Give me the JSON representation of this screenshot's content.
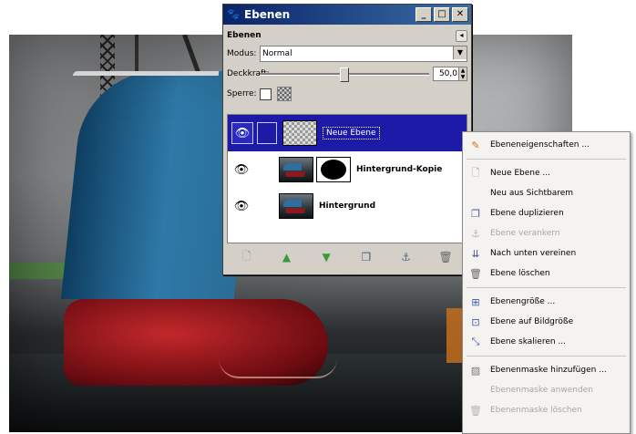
{
  "dialog": {
    "title": "Ebenen",
    "panel_title": "Ebenen",
    "mode_label": "Modus:",
    "mode_value": "Normal",
    "opacity_label": "Deckkraft:",
    "opacity_value": "50,0",
    "opacity_fraction": 0.5,
    "lock_label": "Sperre:",
    "layers": [
      {
        "name": "Neue Ebene",
        "selected": true
      },
      {
        "name": "Hintergrund-Kopie",
        "selected": false
      },
      {
        "name": "Hintergrund",
        "selected": false
      }
    ]
  },
  "context_menu": {
    "items": [
      {
        "label": "Ebeneneigenschaften ...",
        "icon": "edit-icon",
        "enabled": true
      },
      {
        "label": "Neue Ebene ...",
        "icon": "new-document-icon",
        "enabled": true
      },
      {
        "label": "Neu aus Sichtbarem",
        "icon": "",
        "enabled": true
      },
      {
        "label": "Ebene duplizieren",
        "icon": "duplicate-icon",
        "enabled": true
      },
      {
        "label": "Ebene verankern",
        "icon": "anchor-icon",
        "enabled": false
      },
      {
        "label": "Nach unten vereinen",
        "icon": "merge-down-icon",
        "enabled": true
      },
      {
        "label": "Ebene löschen",
        "icon": "trash-icon",
        "enabled": true
      },
      {
        "label": "Ebenengröße ...",
        "icon": "layer-size-icon",
        "enabled": true
      },
      {
        "label": "Ebene auf Bildgröße",
        "icon": "layer-to-image-size-icon",
        "enabled": true
      },
      {
        "label": "Ebene skalieren ...",
        "icon": "scale-icon",
        "enabled": true
      },
      {
        "label": "Ebenenmaske hinzufügen ...",
        "icon": "add-mask-icon",
        "enabled": true
      },
      {
        "label": "Ebenenmaske anwenden",
        "icon": "",
        "enabled": false
      },
      {
        "label": "Ebenenmaske löschen",
        "icon": "trash-icon",
        "enabled": false
      }
    ]
  }
}
